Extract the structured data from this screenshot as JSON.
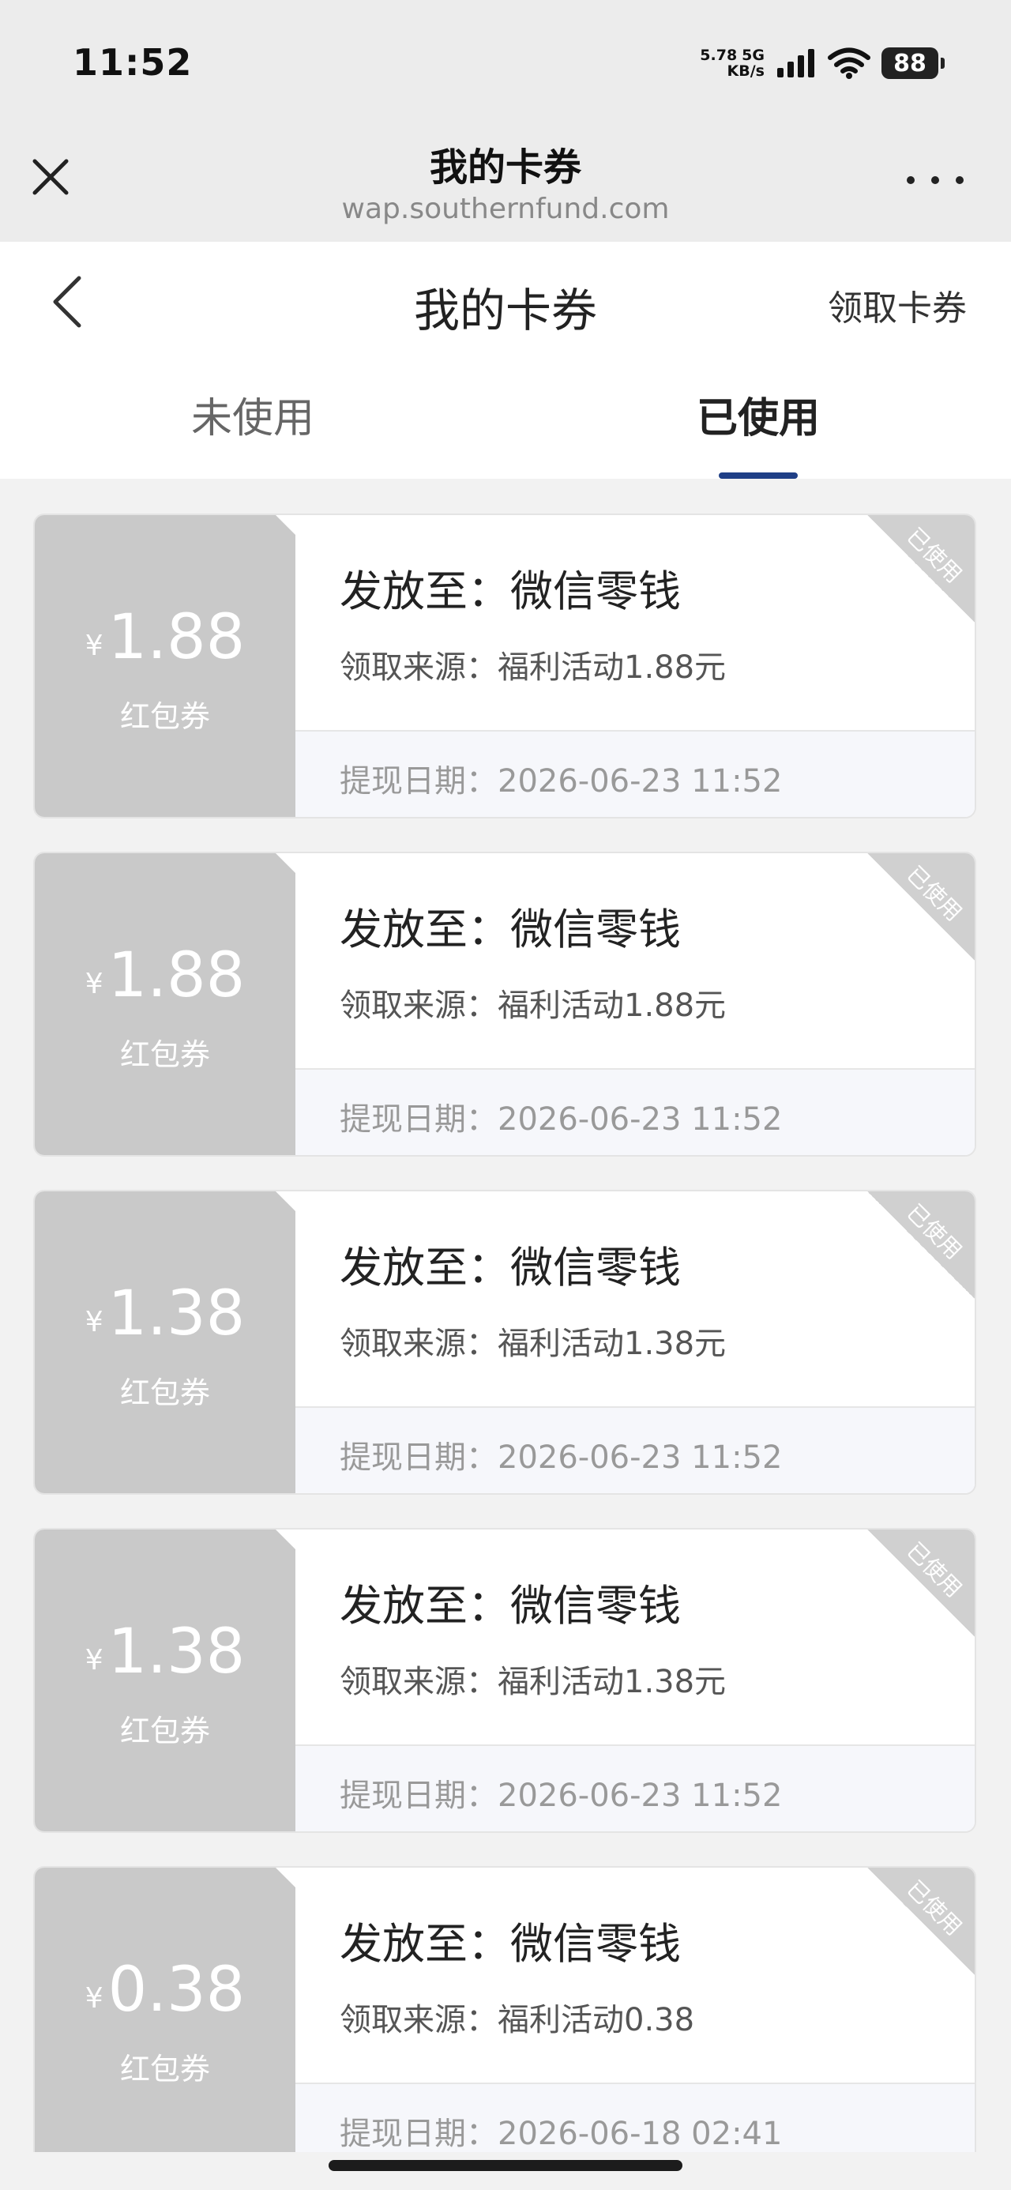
{
  "status_bar": {
    "time": "11:52",
    "net_speed_value": "5.78",
    "net_type": "5G",
    "net_speed_unit": "KB/s",
    "battery": "88"
  },
  "web_header": {
    "title": "我的卡券",
    "url": "wap.southernfund.com"
  },
  "page": {
    "title": "我的卡券",
    "action": "领取卡券"
  },
  "tabs": [
    {
      "label": "未使用",
      "active": false
    },
    {
      "label": "已使用",
      "active": true
    }
  ],
  "coupons": [
    {
      "currency": "¥",
      "amount": "1.88",
      "type": "红包券",
      "destination": "发放至：微信零钱",
      "source": "领取来源：福利活动1.88元",
      "date": "提现日期：2026-06-23 11:52",
      "status": "已使用"
    },
    {
      "currency": "¥",
      "amount": "1.88",
      "type": "红包券",
      "destination": "发放至：微信零钱",
      "source": "领取来源：福利活动1.88元",
      "date": "提现日期：2026-06-23 11:52",
      "status": "已使用"
    },
    {
      "currency": "¥",
      "amount": "1.38",
      "type": "红包券",
      "destination": "发放至：微信零钱",
      "source": "领取来源：福利活动1.38元",
      "date": "提现日期：2026-06-23 11:52",
      "status": "已使用"
    },
    {
      "currency": "¥",
      "amount": "1.38",
      "type": "红包券",
      "destination": "发放至：微信零钱",
      "source": "领取来源：福利活动1.38元",
      "date": "提现日期：2026-06-23 11:52",
      "status": "已使用"
    },
    {
      "currency": "¥",
      "amount": "0.38",
      "type": "红包券",
      "destination": "发放至：微信零钱",
      "source": "领取来源：福利活动0.38",
      "date": "提现日期：2026-06-18 02:41",
      "status": "已使用"
    }
  ],
  "colors": {
    "tab_indicator": "#1f3f86",
    "coupon_left_bg": "#c9c9c9",
    "ribbon": "#d0d0d0"
  }
}
